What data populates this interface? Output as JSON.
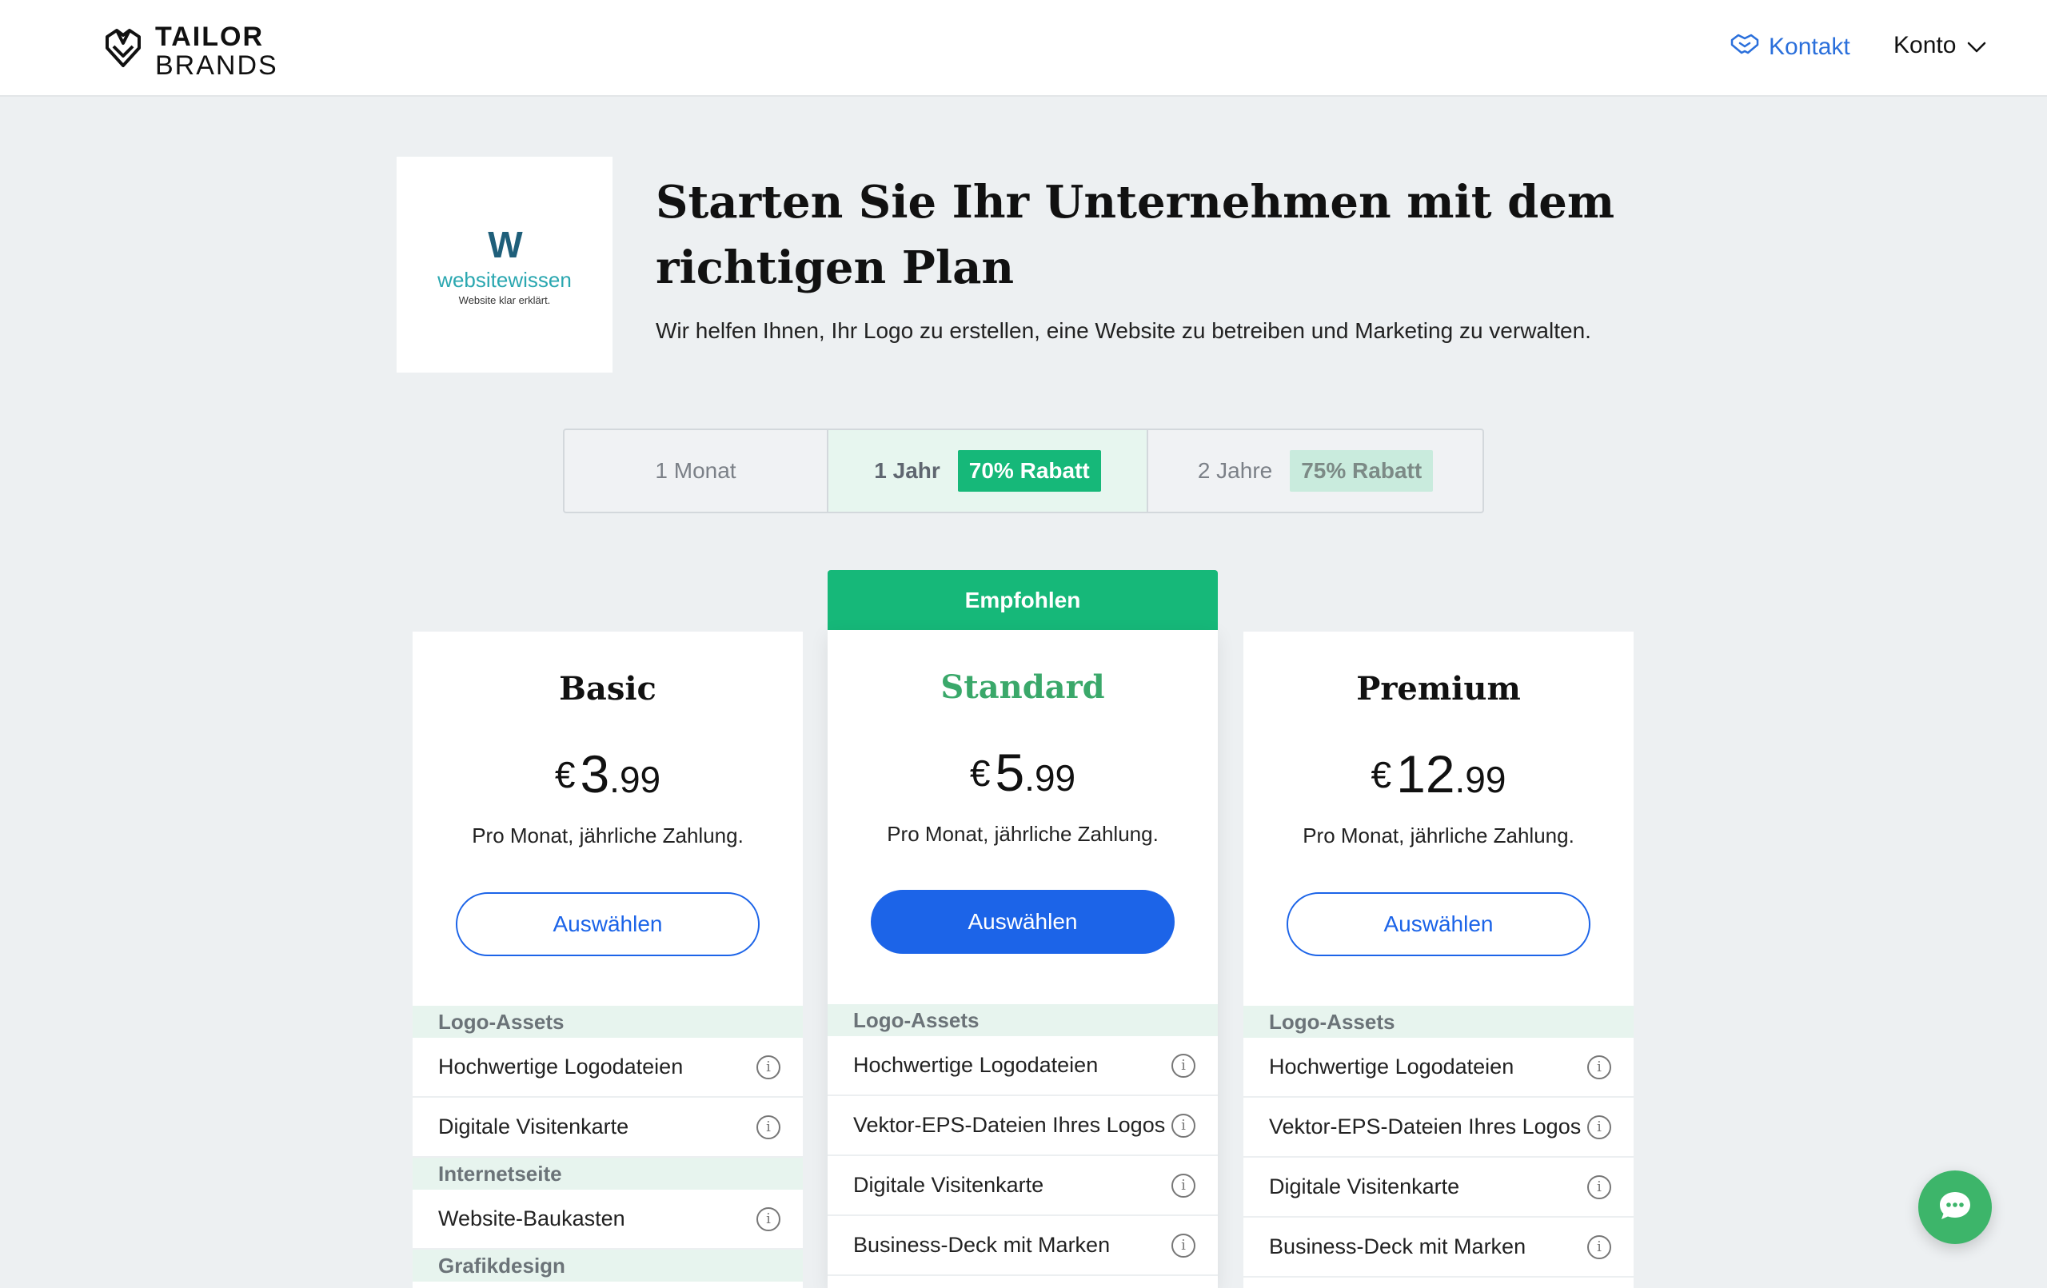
{
  "header": {
    "brand_line1": "TAILOR",
    "brand_line2": "BRANDS",
    "contact_label": "Kontakt",
    "account_label": "Konto",
    "contact_color": "#2a6fdb"
  },
  "intro": {
    "logo": {
      "mark": "W",
      "name": "websitewissen",
      "tagline": "Website klar erklärt."
    },
    "headline": "Starten Sie Ihr Unternehmen mit dem richtigen Plan",
    "subline": "Wir helfen Ihnen, Ihr Logo zu erstellen, eine Website zu betreiben und Marketing zu verwalten."
  },
  "billing_tabs": [
    {
      "label": "1 Monat",
      "badge": ""
    },
    {
      "label": "1 Jahr",
      "badge": "70% Rabatt",
      "selected": true
    },
    {
      "label": "2 Jahre",
      "badge": "75% Rabatt"
    }
  ],
  "recommended_label": "Empfohlen",
  "plans": [
    {
      "name": "Basic",
      "currency": "€",
      "price_int": "3",
      "price_dec": ".99",
      "billing_note": "Pro Monat, jährliche Zahlung.",
      "button": "Auswählen",
      "sections": [
        {
          "title": "Logo-Assets",
          "items": [
            "Hochwertige Logodateien",
            "Digitale Visitenkarte"
          ]
        },
        {
          "title": "Internetseite",
          "items": [
            "Website-Baukasten"
          ]
        },
        {
          "title": "Grafikdesign",
          "items": []
        }
      ]
    },
    {
      "name": "Standard",
      "currency": "€",
      "price_int": "5",
      "price_dec": ".99",
      "billing_note": "Pro Monat, jährliche Zahlung.",
      "button": "Auswählen",
      "sections": [
        {
          "title": "Logo-Assets",
          "items": [
            "Hochwertige Logodateien",
            "Vektor-EPS-Dateien Ihres Logos",
            "Digitale Visitenkarte",
            "Business-Deck mit Marken"
          ]
        }
      ]
    },
    {
      "name": "Premium",
      "currency": "€",
      "price_int": "12",
      "price_dec": ".99",
      "billing_note": "Pro Monat, jährliche Zahlung.",
      "button": "Auswählen",
      "sections": [
        {
          "title": "Logo-Assets",
          "items": [
            "Hochwertige Logodateien",
            "Vektor-EPS-Dateien Ihres Logos",
            "Digitale Visitenkarte",
            "Business-Deck mit Marken"
          ]
        }
      ]
    }
  ],
  "colors": {
    "accent_green": "#16b879",
    "primary_blue": "#1c64e8",
    "section_bg": "#e7f4ee"
  }
}
